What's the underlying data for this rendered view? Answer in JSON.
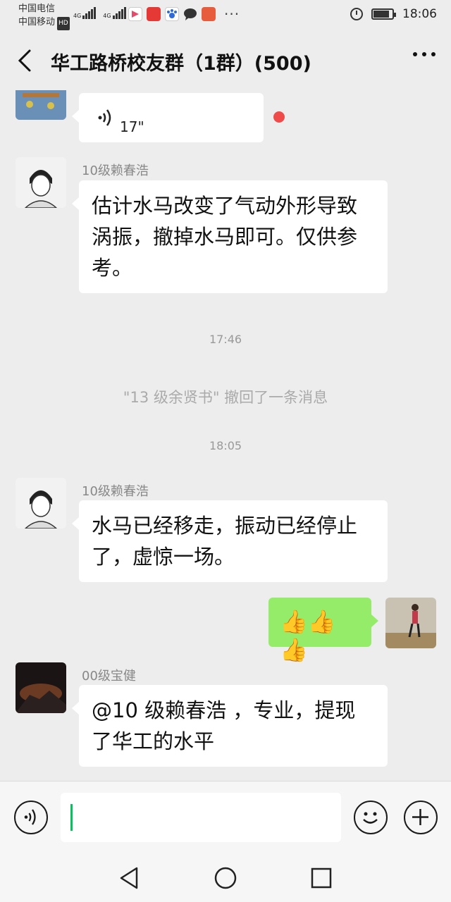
{
  "status_bar": {
    "carrier_1": "中国电信",
    "carrier_2": "中国移动",
    "hd_badge": "HD",
    "signal_1_label": "4G",
    "signal_2_label": "4G",
    "time": "18:06",
    "more_dots": "···"
  },
  "header": {
    "title": "华工路桥校友群（1群）(500)"
  },
  "messages": {
    "voice": {
      "duration": "17\""
    },
    "msg1": {
      "sender": "10级赖春浩",
      "text": "估计水马改变了气动外形导致涡振，撤掉水马即可。仅供参考。"
    },
    "time1": "17:46",
    "recall": "\"13 级余贤书\" 撤回了一条消息",
    "time2": "18:05",
    "msg2": {
      "sender": "10级赖春浩",
      "text": "水马已经移走，振动已经停止了，虚惊一场。"
    },
    "msg3": {
      "text": "👍👍👍"
    },
    "msg4": {
      "sender": "00级宝健",
      "text": "@10 级赖春浩 ，专业，提现了华工的水平"
    }
  },
  "colors": {
    "background": "#ededed",
    "bubble_self": "#95ec69",
    "bubble_other": "#ffffff",
    "unread_dot": "#f04b4b",
    "caret": "#07c160"
  }
}
